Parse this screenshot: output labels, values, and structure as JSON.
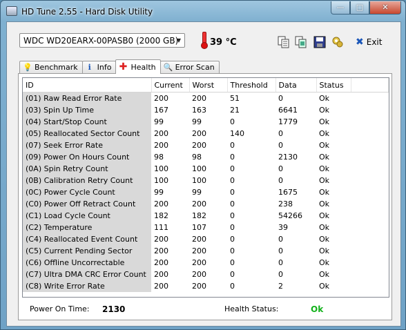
{
  "window": {
    "title": "HD Tune 2.55 - Hard Disk Utility"
  },
  "toolbar": {
    "drive": "WDC WD20EARX-00PASB0 (2000 GB)",
    "temperature": "39 °C",
    "exit_label": "Exit"
  },
  "tabs": [
    {
      "label": "Benchmark",
      "icon": "lightbulb-icon"
    },
    {
      "label": "Info",
      "icon": "info-icon"
    },
    {
      "label": "Health",
      "icon": "health-cross-icon",
      "active": true
    },
    {
      "label": "Error Scan",
      "icon": "magnifier-icon"
    }
  ],
  "table": {
    "columns": [
      "ID",
      "Current",
      "Worst",
      "Threshold",
      "Data",
      "Status"
    ],
    "rows": [
      [
        "(01) Raw Read Error Rate",
        "200",
        "200",
        "51",
        "0",
        "Ok"
      ],
      [
        "(03) Spin Up Time",
        "167",
        "163",
        "21",
        "6641",
        "Ok"
      ],
      [
        "(04) Start/Stop Count",
        "99",
        "99",
        "0",
        "1779",
        "Ok"
      ],
      [
        "(05) Reallocated Sector Count",
        "200",
        "200",
        "140",
        "0",
        "Ok"
      ],
      [
        "(07) Seek Error Rate",
        "200",
        "200",
        "0",
        "0",
        "Ok"
      ],
      [
        "(09) Power On Hours Count",
        "98",
        "98",
        "0",
        "2130",
        "Ok"
      ],
      [
        "(0A) Spin Retry Count",
        "100",
        "100",
        "0",
        "0",
        "Ok"
      ],
      [
        "(0B) Calibration Retry Count",
        "100",
        "100",
        "0",
        "0",
        "Ok"
      ],
      [
        "(0C) Power Cycle Count",
        "99",
        "99",
        "0",
        "1675",
        "Ok"
      ],
      [
        "(C0) Power Off Retract Count",
        "200",
        "200",
        "0",
        "238",
        "Ok"
      ],
      [
        "(C1) Load Cycle Count",
        "182",
        "182",
        "0",
        "54266",
        "Ok"
      ],
      [
        "(C2) Temperature",
        "111",
        "107",
        "0",
        "39",
        "Ok"
      ],
      [
        "(C4) Reallocated Event Count",
        "200",
        "200",
        "0",
        "0",
        "Ok"
      ],
      [
        "(C5) Current Pending Sector",
        "200",
        "200",
        "0",
        "0",
        "Ok"
      ],
      [
        "(C6) Offline Uncorrectable",
        "200",
        "200",
        "0",
        "0",
        "Ok"
      ],
      [
        "(C7) Ultra DMA CRC Error Count",
        "200",
        "200",
        "0",
        "0",
        "Ok"
      ],
      [
        "(C8) Write Error Rate",
        "200",
        "200",
        "0",
        "2",
        "Ok"
      ]
    ]
  },
  "footer": {
    "power_on_label": "Power On Time:",
    "power_on_value": "2130",
    "health_label": "Health Status:",
    "health_value": "Ok"
  },
  "colors": {
    "ok_green": "#11b11a",
    "id_cell_bg": "#d9d9d9"
  }
}
